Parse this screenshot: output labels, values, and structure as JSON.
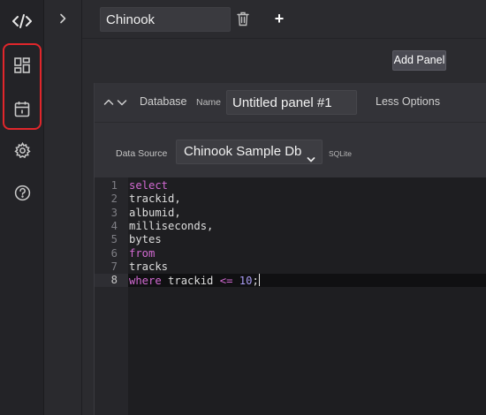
{
  "rail": {
    "items": [
      {
        "icon": "code-icon",
        "label": ""
      },
      {
        "icon": "dashboard-icon",
        "label": ""
      },
      {
        "icon": "calendar-icon",
        "label": ""
      },
      {
        "icon": "gear-icon",
        "label": ""
      },
      {
        "icon": "help-icon",
        "label": ""
      }
    ],
    "highlight_color": "#e0262b"
  },
  "sidebar": {
    "expand_icon": "chevron-right-icon"
  },
  "topbar": {
    "project_name": "Chinook",
    "delete_icon": "trash-icon",
    "add_label": "+"
  },
  "page": {
    "add_panel_label": "Add Panel",
    "panel": {
      "tab_label": "Database",
      "name_label": "Name",
      "name_value": "Untitled panel #1",
      "options_toggle": "Less Options",
      "datasource_label": "Data Source",
      "datasource_value": "Chinook Sample Db",
      "datasource_type": "SQLite",
      "editor": {
        "active_line": 8,
        "lines": [
          "select",
          "trackid,",
          "albumid,",
          "milliseconds,",
          "bytes",
          "from",
          "tracks",
          "where trackid <= 10;"
        ]
      }
    }
  },
  "colors": {
    "keyword": "#d36ad3",
    "number": "#a79af0",
    "background": "#2b2b2f"
  }
}
